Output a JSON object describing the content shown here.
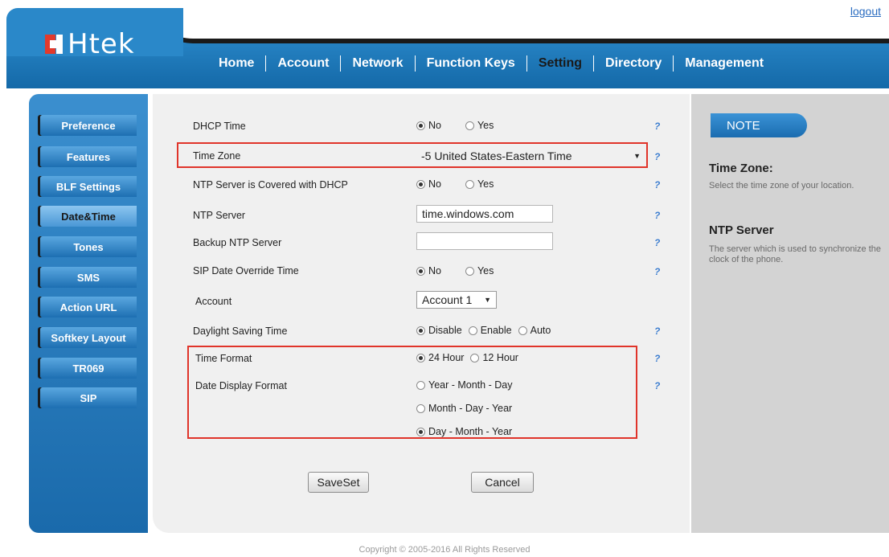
{
  "header": {
    "logo_text": "Htek",
    "logout": "logout",
    "nav": [
      {
        "label": "Home"
      },
      {
        "label": "Account"
      },
      {
        "label": "Network"
      },
      {
        "label": "Function Keys"
      },
      {
        "label": "Setting",
        "active": true
      },
      {
        "label": "Directory"
      },
      {
        "label": "Management"
      }
    ]
  },
  "sidebar": {
    "items": [
      {
        "label": "Preference"
      },
      {
        "label": "Features"
      },
      {
        "label": "BLF Settings"
      },
      {
        "label": "Date&Time",
        "active": true
      },
      {
        "label": "Tones"
      },
      {
        "label": "SMS"
      },
      {
        "label": "Action URL"
      },
      {
        "label": "Softkey Layout"
      },
      {
        "label": "TR069"
      },
      {
        "label": "SIP"
      }
    ]
  },
  "form": {
    "dhcp_time": {
      "label": "DHCP Time",
      "options": [
        "No",
        "Yes"
      ],
      "selected": "No"
    },
    "time_zone": {
      "label": "Time Zone",
      "value": "-5 United States-Eastern Time"
    },
    "ntp_dhcp": {
      "label": "NTP Server is Covered with DHCP",
      "options": [
        "No",
        "Yes"
      ],
      "selected": "No"
    },
    "ntp_server": {
      "label": "NTP Server",
      "value": "time.windows.com"
    },
    "backup_ntp": {
      "label": "Backup NTP Server",
      "value": ""
    },
    "sip_override": {
      "label": "SIP Date Override Time",
      "options": [
        "No",
        "Yes"
      ],
      "selected": "No"
    },
    "account": {
      "label": "Account",
      "value": "Account 1"
    },
    "dst": {
      "label": "Daylight Saving Time",
      "options": [
        "Disable",
        "Enable",
        "Auto"
      ],
      "selected": "Disable"
    },
    "time_format": {
      "label": "Time Format",
      "options": [
        "24 Hour",
        "12 Hour"
      ],
      "selected": "24 Hour"
    },
    "date_format": {
      "label": "Date Display Format",
      "options": [
        "Year - Month - Day",
        "Month - Day - Year",
        "Day - Month - Year"
      ],
      "selected": "Day - Month - Year"
    },
    "help_glyph": "?",
    "saveset": "SaveSet",
    "cancel": "Cancel"
  },
  "note": {
    "tab": "NOTE",
    "sections": [
      {
        "title": "Time Zone:",
        "text": "Select the time zone of your location."
      },
      {
        "title": "NTP Server",
        "text": "The server which is used to synchronize the clock of the phone."
      }
    ]
  },
  "footer": {
    "copyright": "Copyright © 2005-2016 All Rights Reserved"
  },
  "colors": {
    "brand_blue": "#1f78bd",
    "highlight_red": "#e0342a",
    "note_bg": "#d3d3d3"
  }
}
